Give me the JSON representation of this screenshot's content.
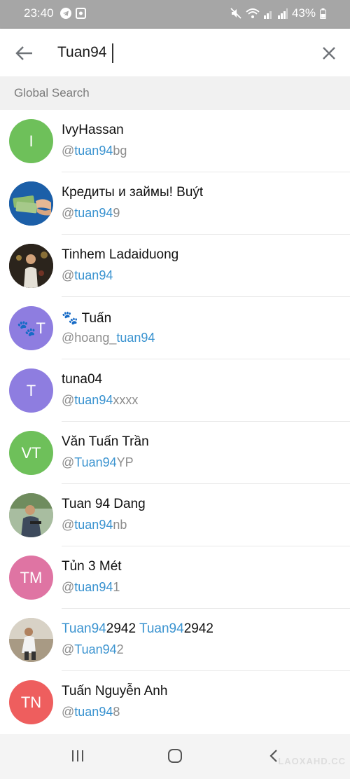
{
  "status_bar": {
    "time": "23:40",
    "battery": "43%"
  },
  "search": {
    "query": "Tuan94"
  },
  "section": {
    "title": "Global Search"
  },
  "results": [
    {
      "name_pre": "",
      "name_hl": "",
      "name_rest": "IvyHassan",
      "handle_pre": "@",
      "handle_hl": "tuan94",
      "handle_rest": "bg",
      "avatar_text": "I",
      "avatar_color": "#6ec05a"
    },
    {
      "name_pre": "",
      "name_hl": "",
      "name_rest": "Кредиты и займы! Buýt",
      "handle_pre": "@",
      "handle_hl": "tuan94",
      "handle_rest": "9",
      "avatar_text": "",
      "avatar_color": "#1c5fa8"
    },
    {
      "name_pre": "",
      "name_hl": "",
      "name_rest": "Tinhem Ladaiduong",
      "handle_pre": "@",
      "handle_hl": "tuan94",
      "handle_rest": "",
      "avatar_text": "",
      "avatar_color": "#2a2a2a"
    },
    {
      "name_pre": "",
      "name_hl": "",
      "name_rest": "🐾 Tuấn",
      "handle_pre": "@hoang_",
      "handle_hl": "tuan94",
      "handle_rest": "",
      "avatar_text": "🐾T",
      "avatar_color": "#8e7de0"
    },
    {
      "name_pre": "",
      "name_hl": "",
      "name_rest": "tuna04",
      "handle_pre": "@",
      "handle_hl": "tuan94",
      "handle_rest": "xxxx",
      "avatar_text": "T",
      "avatar_color": "#8e7de0"
    },
    {
      "name_pre": "",
      "name_hl": "",
      "name_rest": "Văn Tuấn Trần",
      "handle_pre": "@",
      "handle_hl": "Tuan94",
      "handle_rest": "YP",
      "avatar_text": "VT",
      "avatar_color": "#6ec05a"
    },
    {
      "name_pre": "",
      "name_hl": "",
      "name_rest": "Tuan 94 Dang",
      "handle_pre": "@",
      "handle_hl": "tuan94",
      "handle_rest": "nb",
      "avatar_text": "",
      "avatar_color": "#9db08a"
    },
    {
      "name_pre": "",
      "name_hl": "",
      "name_rest": "Tủn 3 Mét",
      "handle_pre": "@",
      "handle_hl": "tuan94",
      "handle_rest": "1",
      "avatar_text": "TM",
      "avatar_color": "#df74a3"
    },
    {
      "name_pre": "",
      "name_hl": "Tuan94",
      "name_rest": "2942 ",
      "name_hl2": "Tuan94",
      "name_rest2": "2942",
      "handle_pre": "@",
      "handle_hl": "Tuan94",
      "handle_rest": "2",
      "avatar_text": "",
      "avatar_color": "#c9c2b5"
    },
    {
      "name_pre": "",
      "name_hl": "",
      "name_rest": "Tuấn Nguyễn Anh",
      "handle_pre": "@",
      "handle_hl": "tuan94",
      "handle_rest": "8",
      "avatar_text": "TN",
      "avatar_color": "#ee5e5e"
    }
  ],
  "watermark": "LAOXAHD.CC"
}
